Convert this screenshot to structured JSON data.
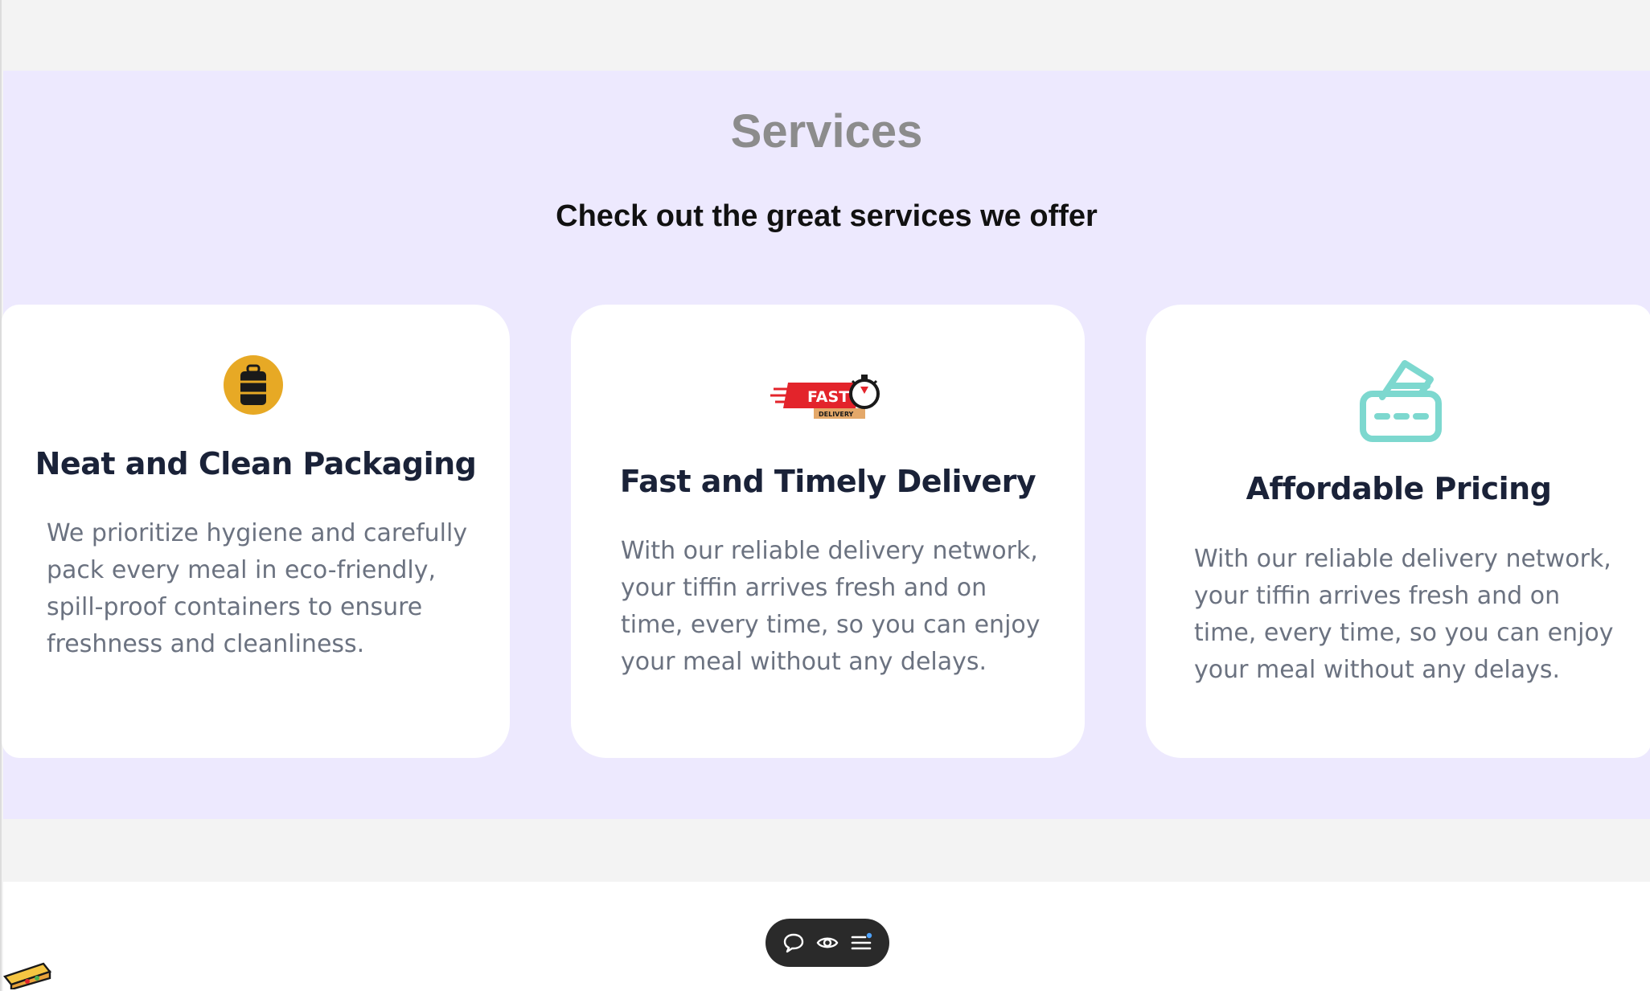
{
  "services": {
    "title": "Services",
    "subtitle": "Check out the great services we offer"
  },
  "cards": [
    {
      "icon": "tiffin-box-icon",
      "title": "Neat and Clean Packaging",
      "lines": [
        "We prioritize hygiene and carefully",
        "pack every meal in eco-friendly,",
        "spill-proof containers to ensure",
        "freshness and cleanliness."
      ]
    },
    {
      "icon": "fast-delivery-icon",
      "title": "Fast and Timely Delivery",
      "badge_text": "FAST",
      "badge_subtext": "DELIVERY",
      "lines": [
        "With our reliable delivery network,",
        "your tiffin arrives fresh and on",
        "time, every time, so you can enjoy",
        "your meal without any delays."
      ]
    },
    {
      "icon": "credit-card-icon",
      "title": "Affordable Pricing",
      "lines": [
        "With our reliable delivery network,",
        "your tiffin arrives fresh and on",
        "time, every time, so you can enjoy",
        "your meal without any delays."
      ]
    }
  ],
  "colors": {
    "section_bg": "#ede9fe",
    "card_bg": "#ffffff",
    "title_gray": "#8c8c8c",
    "heading": "#1a2238",
    "body_text": "#6b7280",
    "tiffin_orange": "#e7a925",
    "delivery_red": "#e3242b",
    "card_teal": "#7dd8cf",
    "toolbar_bg": "#2a2a2a"
  },
  "toolbar": {
    "icons": [
      "comment-icon",
      "eye-icon",
      "menu-icon"
    ]
  }
}
